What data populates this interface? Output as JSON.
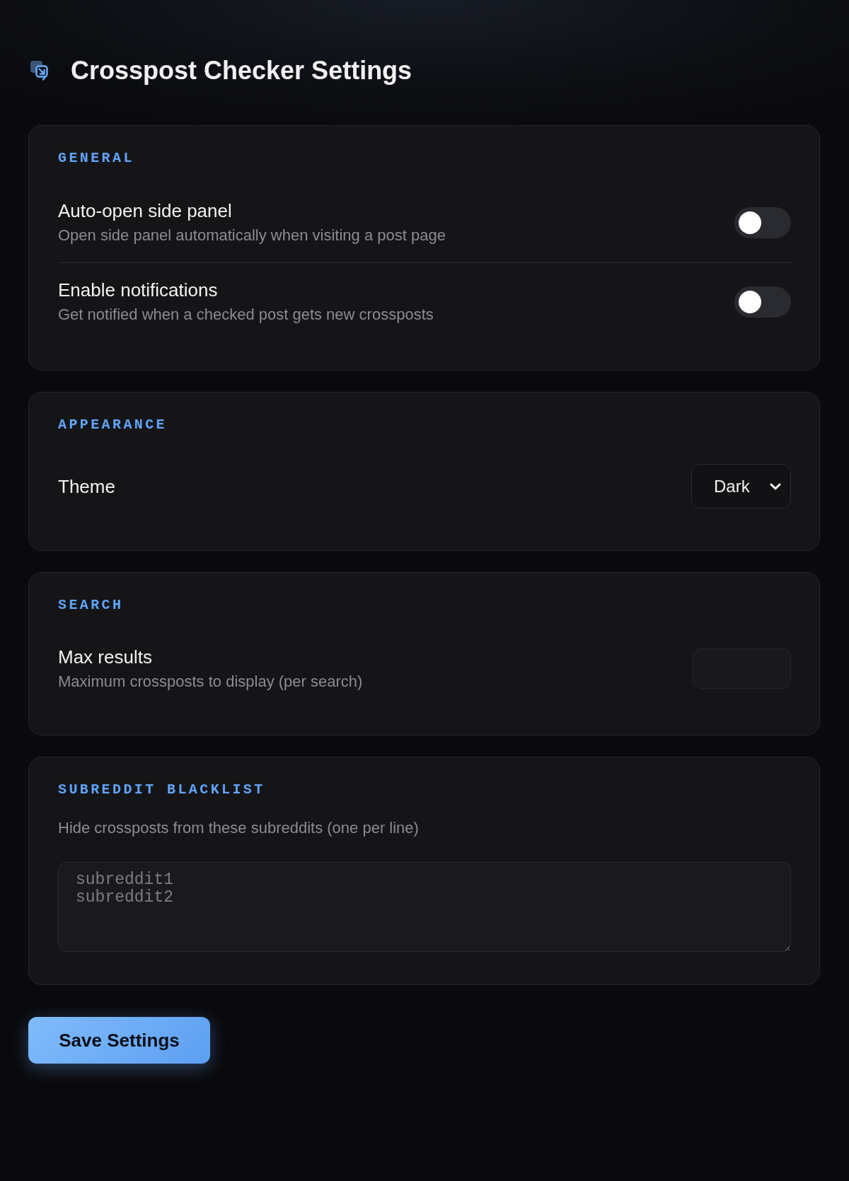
{
  "header": {
    "title": "Crosspost Checker Settings"
  },
  "sections": [
    {
      "title": "GENERAL",
      "rows": [
        {
          "kind": "toggle",
          "label": "Auto-open side panel",
          "description": "Open side panel automatically when visiting a post page",
          "on": false
        },
        {
          "kind": "toggle",
          "label": "Enable notifications",
          "description": "Get notified when a checked post gets new crossposts",
          "on": false
        }
      ]
    },
    {
      "title": "APPEARANCE",
      "rows": [
        {
          "kind": "select",
          "label": "Theme",
          "value": "Dark"
        }
      ]
    },
    {
      "title": "SEARCH",
      "rows": [
        {
          "kind": "number",
          "label": "Max results",
          "description": "Maximum crossposts to display (per search)"
        }
      ]
    },
    {
      "title": "SUBREDDIT BLACKLIST",
      "rows": [
        {
          "kind": "textarea",
          "description": "Hide crossposts from these subreddits (one per line)",
          "placeholder": "subreddit1\nsubreddit2"
        }
      ]
    }
  ],
  "save_button": {
    "label": "Save Settings"
  }
}
